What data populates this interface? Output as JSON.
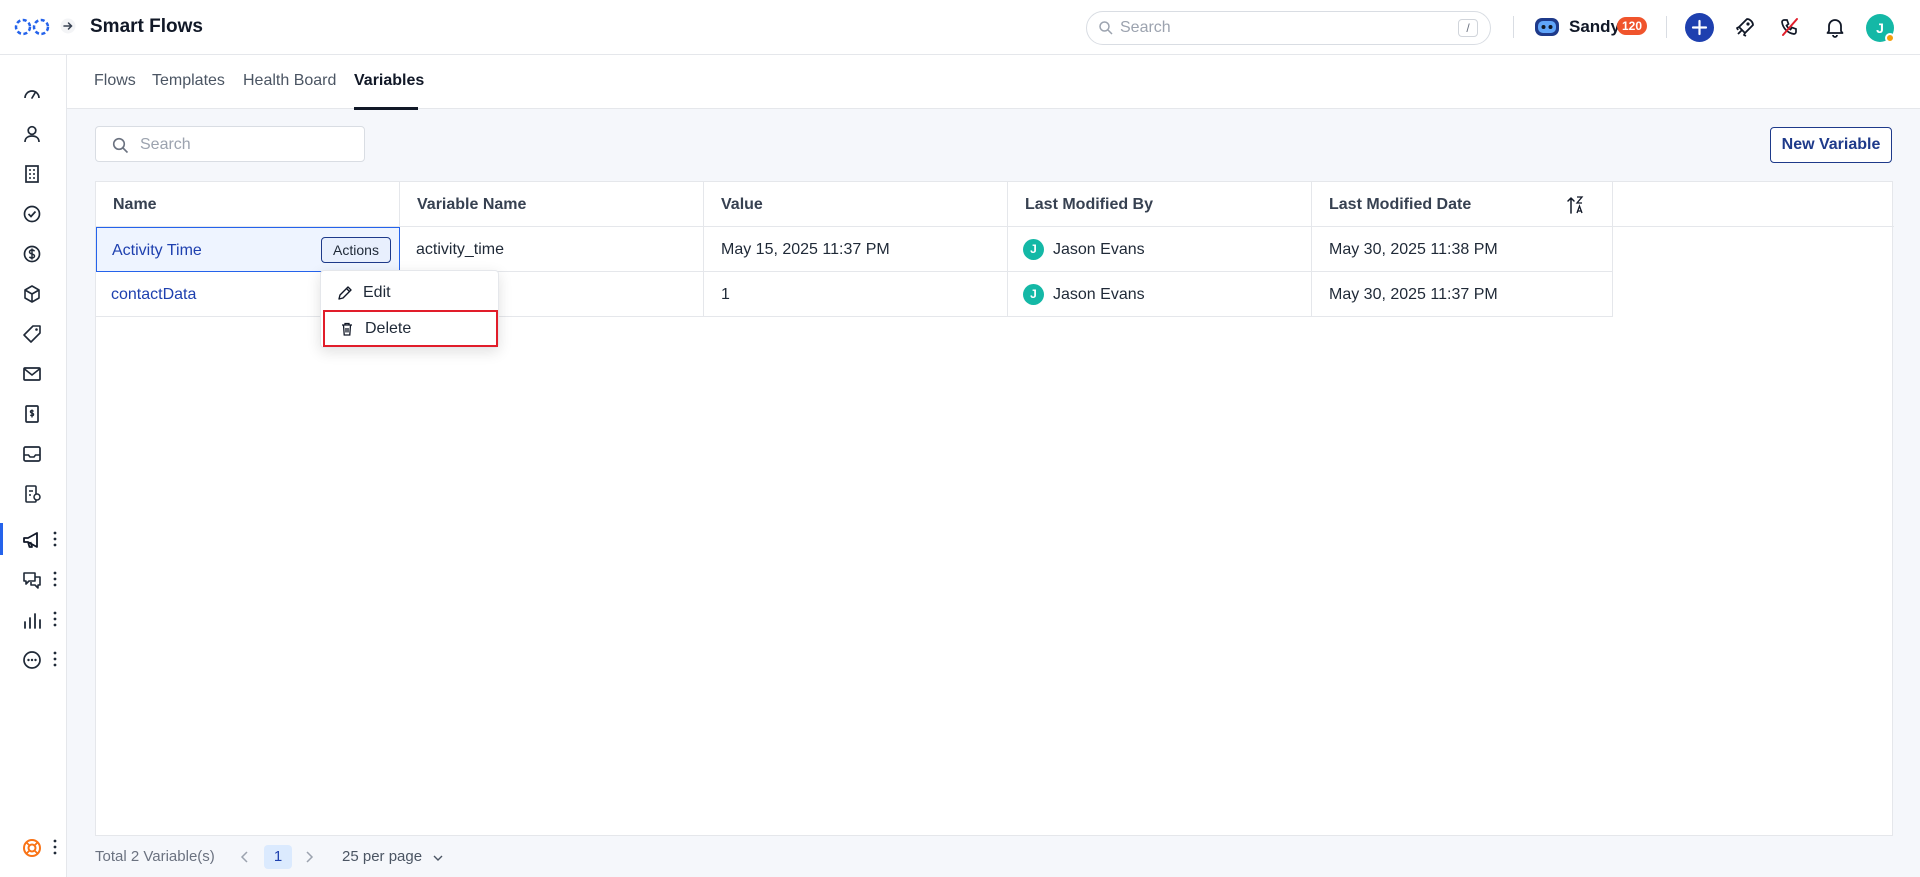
{
  "header": {
    "title": "Smart Flows",
    "search_placeholder": "Search",
    "search_shortcut": "/",
    "user_name": "Sandy",
    "credits": "120",
    "avatar_initial": "J"
  },
  "sidebar": {
    "icons": [
      "dashboard-icon",
      "contacts-icon",
      "building-icon",
      "tasks-icon",
      "dollar-icon",
      "package-icon",
      "tag-icon",
      "mail-icon",
      "invoice-icon",
      "inbox-icon",
      "workflow-icon",
      "megaphone-icon",
      "chat-icon",
      "reports-icon",
      "more-icon",
      "help-icon"
    ],
    "active": "megaphone-icon"
  },
  "tabs": [
    {
      "label": "Flows"
    },
    {
      "label": "Templates"
    },
    {
      "label": "Health Board"
    },
    {
      "label": "Variables",
      "active": true
    }
  ],
  "toolbar": {
    "search_placeholder": "Search",
    "new_variable_label": "New Variable"
  },
  "table": {
    "columns": [
      "Name",
      "Variable Name",
      "Value",
      "Last Modified By",
      "Last Modified Date"
    ],
    "rows": [
      {
        "name": "Activity Time",
        "variable_name": "activity_time",
        "value": "May 15, 2025 11:37 PM",
        "modified_by": "Jason Evans",
        "modified_by_initial": "J",
        "modified_date": "May 30, 2025 11:38 PM"
      },
      {
        "name": "contactData",
        "variable_name": "",
        "value": "1",
        "modified_by": "Jason Evans",
        "modified_by_initial": "J",
        "modified_date": "May 30, 2025 11:37 PM"
      }
    ],
    "actions_label": "Actions"
  },
  "actions_menu": {
    "edit_label": "Edit",
    "delete_label": "Delete"
  },
  "footer": {
    "total": "Total 2 Variable(s)",
    "current_page": "1",
    "per_page": "25 per page"
  },
  "colors": {
    "accent": "#1e40af",
    "active_bar": "#2563eb",
    "badge": "#f0542c",
    "avatar": "#14b8a6",
    "highlight": "#e11d2a"
  }
}
